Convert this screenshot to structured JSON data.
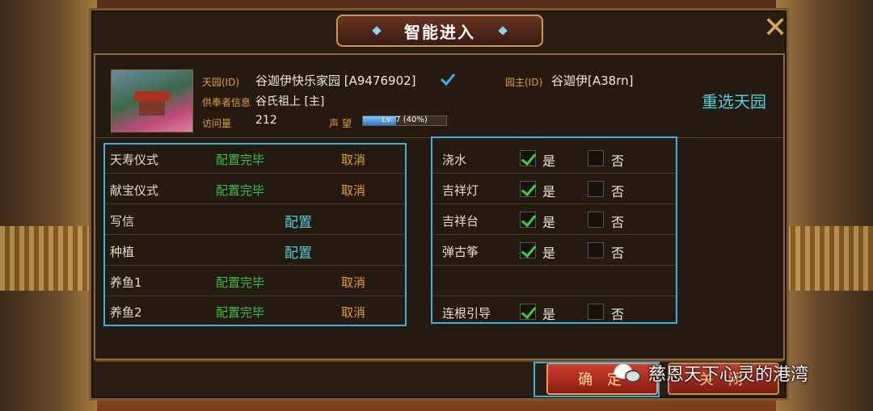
{
  "dialog": {
    "title": "智能进入",
    "close_glyph": "✕",
    "reselect_label": "重选天园"
  },
  "info": {
    "garden_label": "天园(ID)",
    "garden_value": "谷迦伊快乐家园 [A9476902]",
    "owner_label": "园主(ID)",
    "owner_value": "谷迦伊[A38rn]",
    "worshipper_label": "供奉者信息",
    "worshipper_value": "谷氏祖上 [主]",
    "visits_label": "访问量",
    "visits_value": "212",
    "reputation_label": "声 望",
    "reputation_text": "Lv. 7 (40%)",
    "reputation_progress": 0.4
  },
  "left_rows": [
    {
      "name": "天寿仪式",
      "status": "配置完毕",
      "action": "取消"
    },
    {
      "name": "献宝仪式",
      "status": "配置完毕",
      "action": "取消"
    },
    {
      "name": "写信",
      "config": "配置"
    },
    {
      "name": "种植",
      "config": "配置"
    },
    {
      "name": "养鱼1",
      "status": "配置完毕",
      "action": "取消"
    },
    {
      "name": "养鱼2",
      "status": "配置完毕",
      "action": "取消"
    }
  ],
  "right_rows": [
    {
      "name": "浇水",
      "yes": "是",
      "no": "否",
      "yes_checked": true
    },
    {
      "name": "吉祥灯",
      "yes": "是",
      "no": "否",
      "yes_checked": true
    },
    {
      "name": "吉祥台",
      "yes": "是",
      "no": "否",
      "yes_checked": true
    },
    {
      "name": "弹古筝",
      "yes": "是",
      "no": "否",
      "yes_checked": true
    },
    {
      "name": "连根引导",
      "yes": "是",
      "no": "否",
      "yes_checked": true
    }
  ],
  "buttons": {
    "confirm": "确 定",
    "close": "关 闭"
  },
  "watermark": "慈恩天下心灵的港湾",
  "colors": {
    "accent_cyan": "#4ed0e0",
    "status_green": "#3ac040",
    "cancel_orange": "#e8a020"
  }
}
